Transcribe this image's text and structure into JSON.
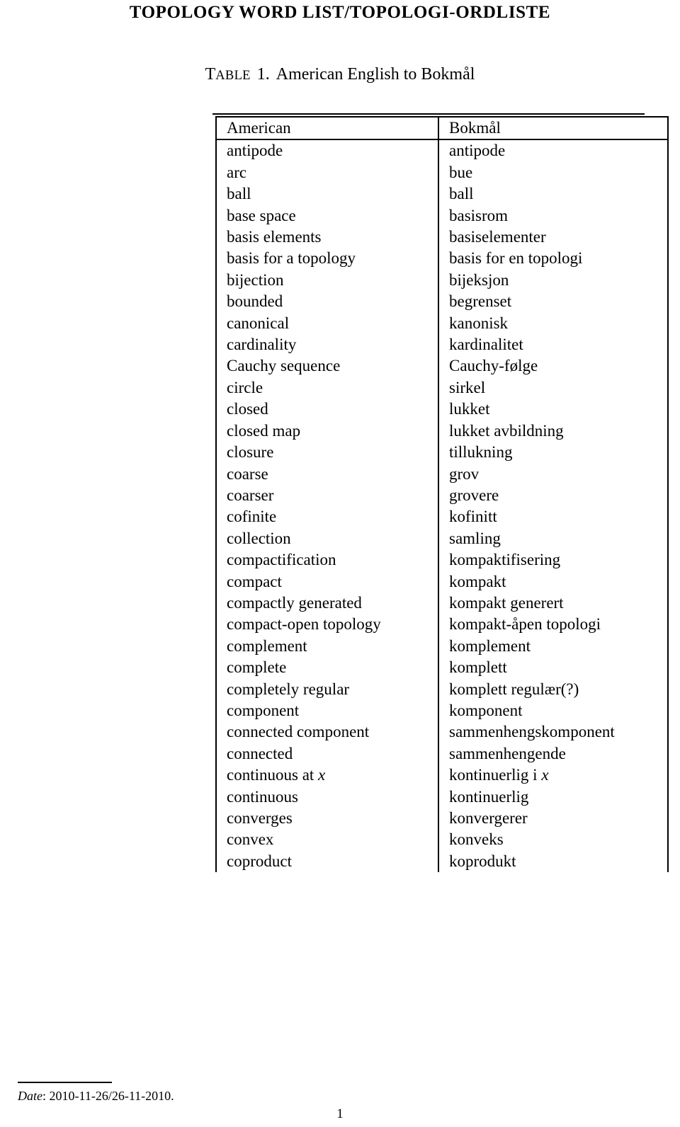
{
  "document": {
    "title": "TOPOLOGY WORD LIST/TOPOLOGI-ORDLISTE",
    "page_number": "1"
  },
  "table": {
    "caption_label_lead": "T",
    "caption_label_rest": "ABLE",
    "caption_number": "1.",
    "caption_text": "American English to Bokmål",
    "columns": [
      "American",
      "Bokmål"
    ],
    "rows": [
      {
        "american": "antipode",
        "bokmal": "antipode"
      },
      {
        "american": "arc",
        "bokmal": "bue"
      },
      {
        "american": "ball",
        "bokmal": "ball"
      },
      {
        "american": "base space",
        "bokmal": "basisrom"
      },
      {
        "american": "basis elements",
        "bokmal": "basiselementer"
      },
      {
        "american": "basis for a topology",
        "bokmal": "basis for en topologi"
      },
      {
        "american": "bijection",
        "bokmal": "bijeksjon"
      },
      {
        "american": "bounded",
        "bokmal": "begrenset"
      },
      {
        "american": "canonical",
        "bokmal": "kanonisk"
      },
      {
        "american": "cardinality",
        "bokmal": "kardinalitet"
      },
      {
        "american": "Cauchy sequence",
        "bokmal": "Cauchy-følge"
      },
      {
        "american": "circle",
        "bokmal": "sirkel"
      },
      {
        "american": "closed",
        "bokmal": "lukket"
      },
      {
        "american": "closed map",
        "bokmal": "lukket avbildning"
      },
      {
        "american": "closure",
        "bokmal": "tillukning"
      },
      {
        "american": "coarse",
        "bokmal": "grov"
      },
      {
        "american": "coarser",
        "bokmal": "grovere"
      },
      {
        "american": "cofinite",
        "bokmal": "kofinitt"
      },
      {
        "american": "collection",
        "bokmal": "samling"
      },
      {
        "american": "compactification",
        "bokmal": "kompaktifisering"
      },
      {
        "american": "compact",
        "bokmal": "kompakt"
      },
      {
        "american": "compactly generated",
        "bokmal": "kompakt generert"
      },
      {
        "american": "compact-open topology",
        "bokmal": "kompakt-åpen topologi"
      },
      {
        "american": "complement",
        "bokmal": "komplement"
      },
      {
        "american": "complete",
        "bokmal": "komplett"
      },
      {
        "american": "completely regular",
        "bokmal": "komplett regulær(?)"
      },
      {
        "american": "component",
        "bokmal": "komponent"
      },
      {
        "american": "connected component",
        "bokmal": "sammenhengskomponent"
      },
      {
        "american": "connected",
        "bokmal": "sammenhengende"
      },
      {
        "american": "continuous at x",
        "american_prefix": "continuous at ",
        "american_math": "x",
        "bokmal": "kontinuerlig i x",
        "bokmal_prefix": "kontinuerlig i ",
        "bokmal_math": "x"
      },
      {
        "american": "continuous",
        "bokmal": "kontinuerlig"
      },
      {
        "american": "converges",
        "bokmal": "konvergerer"
      },
      {
        "american": "convex",
        "bokmal": "konveks"
      },
      {
        "american": "coproduct",
        "bokmal": "koprodukt"
      }
    ]
  },
  "footnote": {
    "label": "Date",
    "separator": ": ",
    "value": "2010-11-26/26-11-2010."
  }
}
